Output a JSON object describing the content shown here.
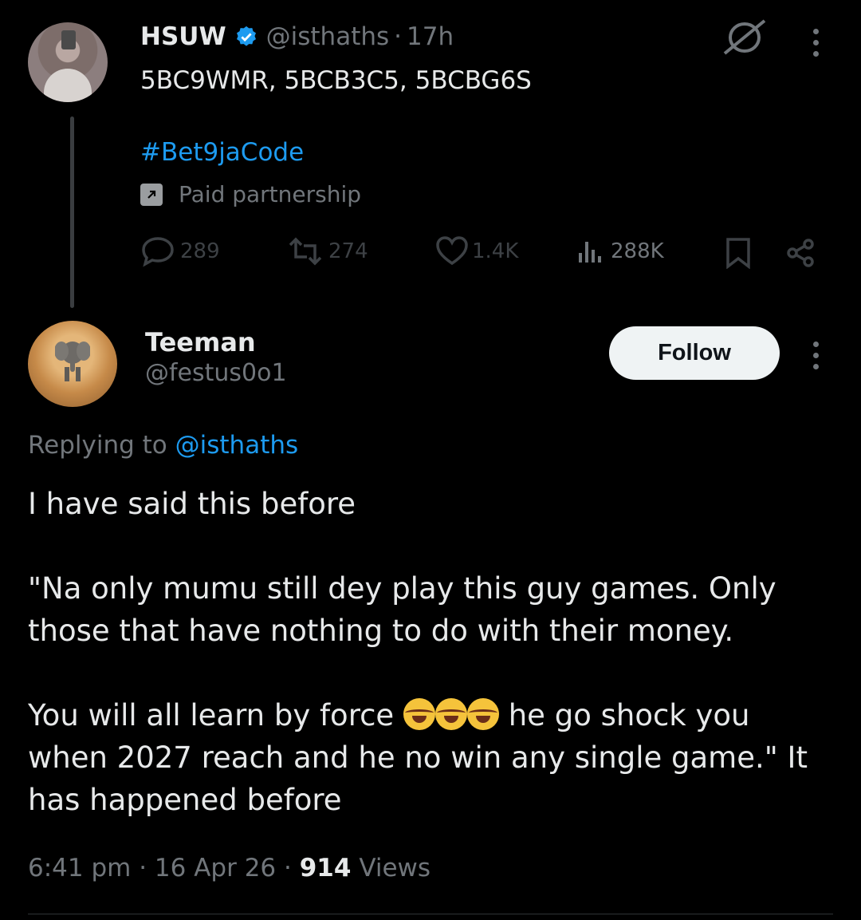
{
  "tweet1": {
    "display_name": "HSUW",
    "handle": "@isthaths",
    "separator": "·",
    "time_ago": "17h",
    "codes": "5BC9WMR, 5BCB3C5, 5BCBG6S",
    "hashtag": "#Bet9jaCode",
    "paid_label": "Paid partnership",
    "stats": {
      "replies": "289",
      "retweets": "274",
      "likes": "1.4K",
      "views": "288K"
    }
  },
  "reply": {
    "display_name": "Teeman",
    "handle": "@festus0o1",
    "follow_label": "Follow",
    "replying_prefix": "Replying to",
    "replying_handle": "@isthaths",
    "text_1": "I have said this before\n\n\"Na only mumu still dey play this guy games. Only those that have nothing to do with their money.\n\nYou will all learn by force ",
    "text_2": " he go shock you when 2027 reach and he no win any single game.\" It has happened before",
    "time": "6:41 pm",
    "date": "16 Apr 26",
    "dot": "·",
    "views_count": "914",
    "views_label": "Views"
  },
  "icons": [
    "verified-badge-icon",
    "grok-icon",
    "more-icon",
    "reply-icon",
    "retweet-icon",
    "like-icon",
    "views-icon",
    "bookmark-icon",
    "share-icon",
    "paid-arrow-icon",
    "laughing-emoji-icon"
  ],
  "colors": {
    "accent": "#1d9bf0",
    "background": "#000000",
    "muted": "#71767b"
  }
}
